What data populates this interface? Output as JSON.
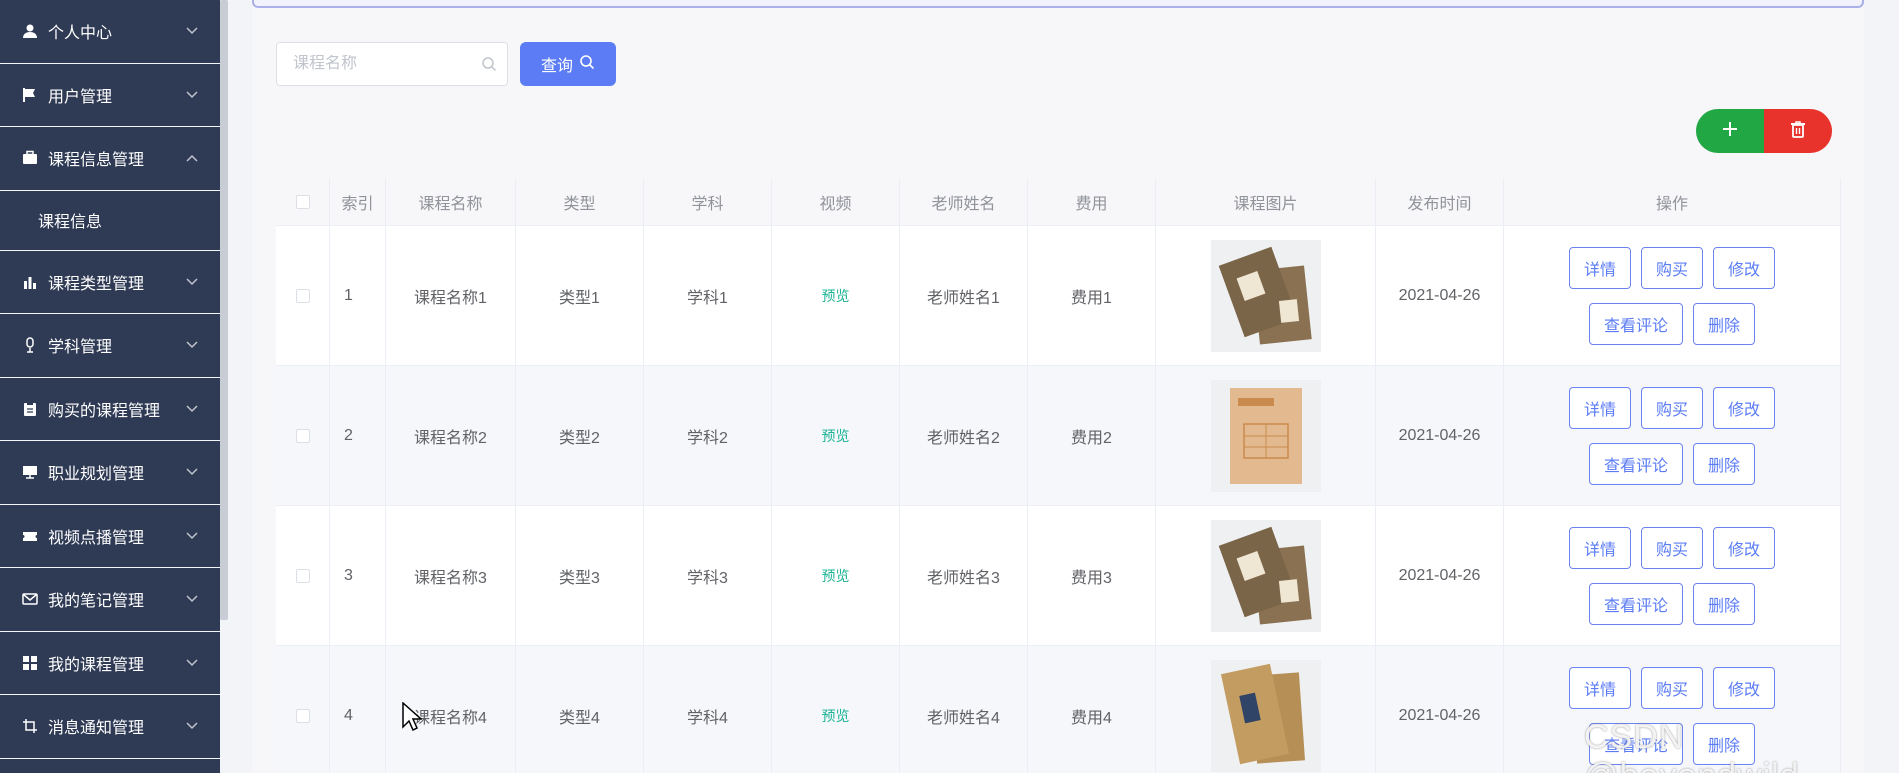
{
  "sidebar": {
    "items": [
      {
        "label": "个人中心",
        "icon": "user-icon"
      },
      {
        "label": "用户管理",
        "icon": "flag-icon"
      },
      {
        "label": "课程信息管理",
        "icon": "briefcase-icon",
        "expanded": true,
        "sub": [
          "课程信息"
        ]
      },
      {
        "label": "课程类型管理",
        "icon": "bar-chart-icon"
      },
      {
        "label": "学科管理",
        "icon": "microphone-icon"
      },
      {
        "label": "购买的课程管理",
        "icon": "clipboard-icon"
      },
      {
        "label": "职业规划管理",
        "icon": "monitor-icon"
      },
      {
        "label": "视频点播管理",
        "icon": "ticket-icon"
      },
      {
        "label": "我的笔记管理",
        "icon": "mail-icon"
      },
      {
        "label": "我的课程管理",
        "icon": "grid-icon"
      },
      {
        "label": "消息通知管理",
        "icon": "crop-icon"
      }
    ]
  },
  "search": {
    "placeholder": "课程名称",
    "button": "查询"
  },
  "table": {
    "headers": [
      "索引",
      "课程名称",
      "类型",
      "学科",
      "视频",
      "老师姓名",
      "费用",
      "课程图片",
      "发布时间",
      "操作"
    ],
    "rows": [
      {
        "index": "1",
        "name": "课程名称1",
        "type": "类型1",
        "subject": "学科1",
        "video": "预览",
        "teacher": "老师姓名1",
        "fee": "费用1",
        "date": "2021-04-26"
      },
      {
        "index": "2",
        "name": "课程名称2",
        "type": "类型2",
        "subject": "学科2",
        "video": "预览",
        "teacher": "老师姓名2",
        "fee": "费用2",
        "date": "2021-04-26"
      },
      {
        "index": "3",
        "name": "课程名称3",
        "type": "类型3",
        "subject": "学科3",
        "video": "预览",
        "teacher": "老师姓名3",
        "fee": "费用3",
        "date": "2021-04-26"
      },
      {
        "index": "4",
        "name": "课程名称4",
        "type": "类型4",
        "subject": "学科4",
        "video": "预览",
        "teacher": "老师姓名4",
        "fee": "费用4",
        "date": "2021-04-26"
      }
    ],
    "actions": {
      "detail": "详情",
      "buy": "购买",
      "edit": "修改",
      "comments": "查看评论",
      "delete": "删除"
    }
  },
  "watermark": "CSDN @beyondwild",
  "colors": {
    "sidebar": "#2f3a55",
    "primary": "#5b7cf5",
    "add": "#22a745",
    "delete": "#e8332d",
    "preview": "#1ab394"
  }
}
